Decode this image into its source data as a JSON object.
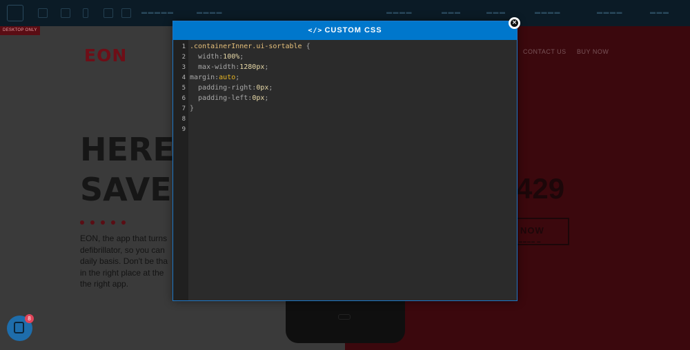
{
  "topbar": {
    "items": [
      "",
      "",
      "",
      "",
      "",
      "",
      ""
    ],
    "right_items": [
      "",
      "",
      "",
      "",
      "",
      ""
    ]
  },
  "desktop_tag": "DESKTOP ONLY",
  "page": {
    "logo": "EON",
    "nav": [
      "CONTACT US",
      "BUY NOW"
    ],
    "hero_lines": [
      "HERE T",
      "SAVE L"
    ],
    "hero_text": "EON, the app that turns ... defibrillator, so you can ... daily basis. Don't be tha... in the right place at the ... the right app.",
    "hero_text_lines": [
      "EON, the app that turns",
      "defibrillator, so you can",
      "daily basis. Don't be tha",
      "in the right place at the",
      "the right app."
    ],
    "price": "429",
    "buy_label": "Y NOW"
  },
  "modal": {
    "title": "CUSTOM CSS",
    "line_numbers": [
      "1",
      "2",
      "3",
      "4",
      "5",
      "6",
      "7",
      "8",
      "9"
    ]
  },
  "chat": {
    "badge": "8"
  }
}
